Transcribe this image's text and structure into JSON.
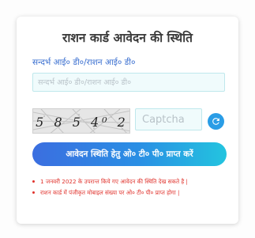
{
  "form": {
    "title": "राशन कार्ड आवेदन की स्थिति",
    "reference_label": "सन्दर्भ आई० डी०/राशन आई० डी०",
    "reference_placeholder": "सन्दर्भ आई० डी०/राशन आई० डी०",
    "captcha_text": "5 8 5 4⁰ 2",
    "captcha_placeholder": "Captcha",
    "submit_label": "आवेदन स्थिति हेतु ओ० टी० पी० प्राप्त करें"
  },
  "notes": [
    "1 जनवरी 2022 के उपरान्त किये गए आवेदन की स्थिति देख सकते है |",
    "राशन कार्ड में पंजीकृत मोबाइल संख्या पर ओ० टी० पी० प्राप्त होगा |"
  ],
  "colors": {
    "label": "#3a6fd0",
    "button_start": "#3b6ee0",
    "button_end": "#23c4df",
    "refresh": "#2a9de6",
    "note": "#e0312b"
  },
  "icons": {
    "refresh": "refresh-icon"
  }
}
